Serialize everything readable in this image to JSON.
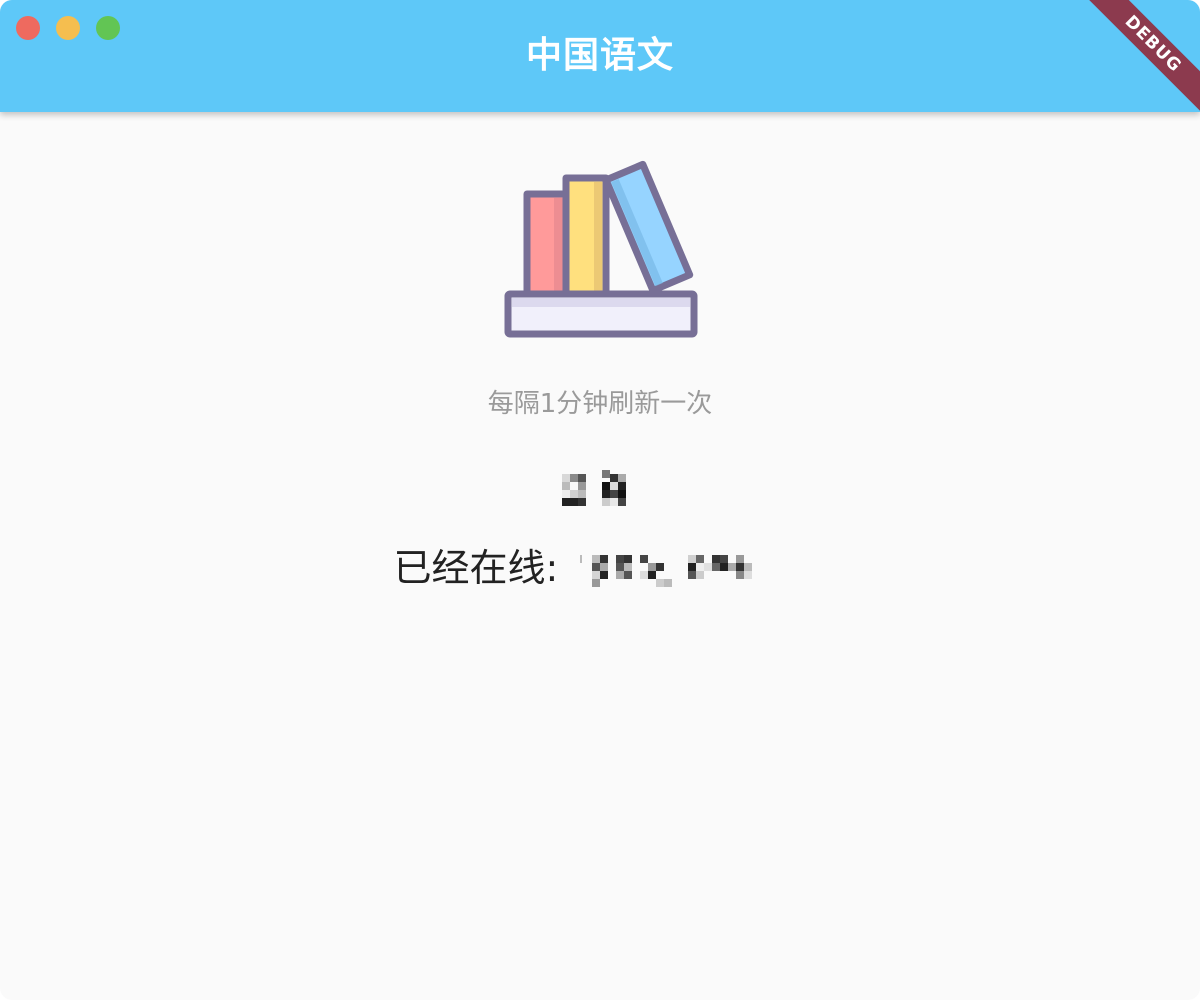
{
  "window": {
    "title": "中国语文",
    "debug_label": "DEBUG"
  },
  "main": {
    "refresh_note": "每隔1分钟刷新一次",
    "online_label": "已经在线:",
    "icon": "books-on-shelf-icon"
  },
  "colors": {
    "appbar": "#5ec8f8",
    "debug": "#8c3a4e",
    "close": "#ee6a5f",
    "minimize": "#f5be4f",
    "zoom": "#62c554"
  }
}
